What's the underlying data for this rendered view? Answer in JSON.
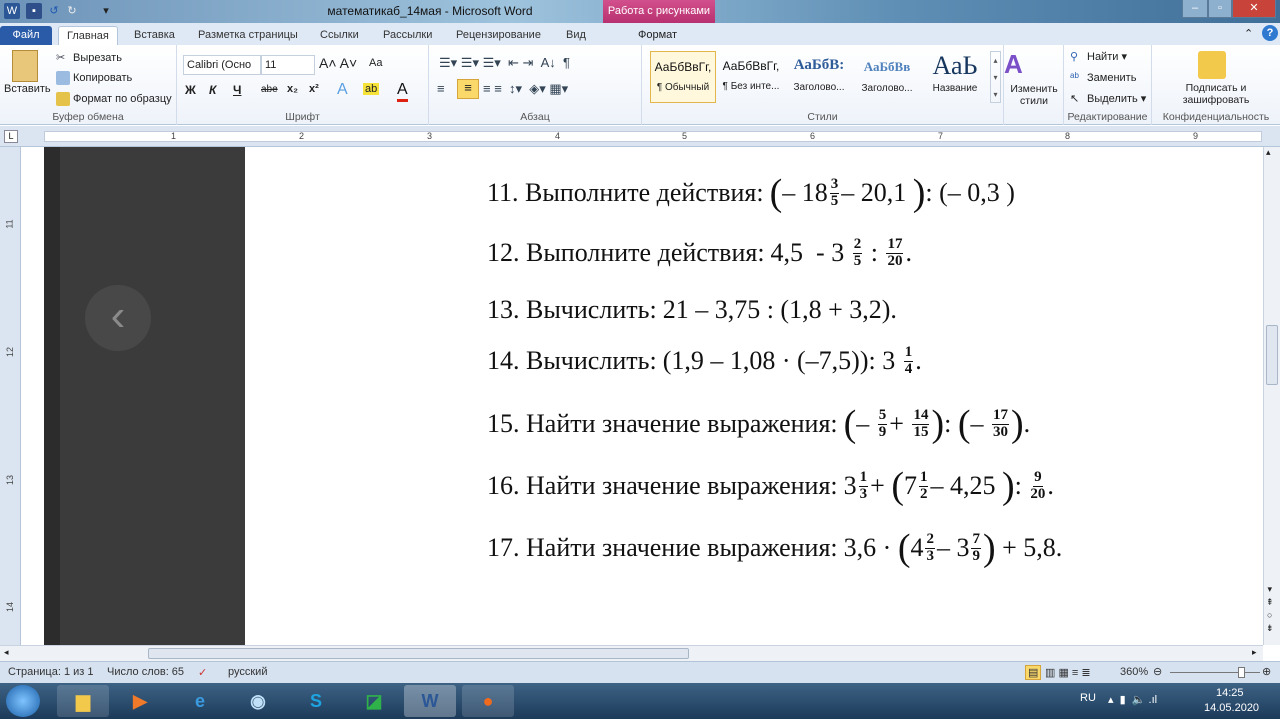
{
  "window": {
    "title": "математикаб_14мая  -  Microsoft Word",
    "context_group": "Работа с рисунками",
    "quick_access": [
      "W",
      "save",
      "undo",
      "redo",
      "customize"
    ]
  },
  "tabs": [
    "Файл",
    "Главная",
    "Вставка",
    "Разметка страницы",
    "Ссылки",
    "Рассылки",
    "Рецензирование",
    "Вид",
    "Формат"
  ],
  "ribbon": {
    "clipboard": {
      "label": "Буфер обмена",
      "paste": "Вставить",
      "cut": "Вырезать",
      "copy": "Копировать",
      "format_painter": "Формат по образцу"
    },
    "font": {
      "label": "Шрифт",
      "font_name": "Calibri (Осно",
      "font_size": "11",
      "bold": "Ж",
      "italic": "К",
      "underline": "Ч",
      "strike": "abe",
      "sub": "x₂",
      "sup": "x²",
      "case": "Aa"
    },
    "paragraph": {
      "label": "Абзац"
    },
    "styles": {
      "label": "Стили",
      "items": [
        {
          "sample": "АаБбВвГг,",
          "name": "¶ Обычный"
        },
        {
          "sample": "АаБбВвГг,",
          "name": "¶ Без инте..."
        },
        {
          "sample": "АаБбВ:",
          "name": "Заголово..."
        },
        {
          "sample": "АаБбВв",
          "name": "Заголово..."
        },
        {
          "sample": "АаЬ",
          "name": "Название"
        }
      ],
      "change": "Изменить стили"
    },
    "editing": {
      "label": "Редактирование",
      "find": "Найти",
      "replace": "Заменить",
      "select": "Выделить"
    },
    "privacy": {
      "label": "Конфиденциальность",
      "sign": "Подписать и зашифровать"
    }
  },
  "ruler": {
    "h": [
      "1",
      "2",
      "3",
      "4",
      "5",
      "6",
      "7",
      "8",
      "9"
    ],
    "v": [
      "11",
      "12",
      "13",
      "14"
    ]
  },
  "document": {
    "problems": [
      {
        "label": "11. Выполните действия:",
        "expr": [
          {
            "t": "("
          },
          {
            "t": "– 18"
          },
          {
            "n": "3",
            "d": "5"
          },
          {
            "t": "– 20,1 "
          },
          {
            "t": ")"
          },
          {
            "t": ": (– 0,3 )"
          }
        ]
      },
      {
        "label": "12. Выполните действия:",
        "expr": [
          {
            "t": "4,5  - 3 "
          },
          {
            "n": "2",
            "d": "5"
          },
          {
            "t": " : "
          },
          {
            "n": "17",
            "d": "20"
          },
          {
            "t": "."
          }
        ]
      },
      {
        "label": "13. Вычислить:",
        "expr": [
          {
            "t": "21 – 3,75 : (1,8 + 3,2)."
          }
        ]
      },
      {
        "label": "14. Вычислить:",
        "expr": [
          {
            "t": "(1,9 – 1,08 · (–7,5)): 3 "
          },
          {
            "n": "1",
            "d": "4"
          },
          {
            "t": "."
          }
        ]
      },
      {
        "label": "15. Найти значение выражения:",
        "expr": [
          {
            "t": "("
          },
          {
            "t": "– "
          },
          {
            "n": "5",
            "d": "9"
          },
          {
            "t": "+ "
          },
          {
            "n": "14",
            "d": "15"
          },
          {
            "t": ")"
          },
          {
            "t": ": "
          },
          {
            "t": "("
          },
          {
            "t": "– "
          },
          {
            "n": "17",
            "d": "30"
          },
          {
            "t": ")"
          },
          {
            "t": "."
          }
        ]
      },
      {
        "label": "16. Найти значение выражения:",
        "expr": [
          {
            "t": "3"
          },
          {
            "n": "1",
            "d": "3"
          },
          {
            "t": "+ "
          },
          {
            "t": "("
          },
          {
            "t": "7"
          },
          {
            "n": "1",
            "d": "2"
          },
          {
            "t": "– 4,25 "
          },
          {
            "t": ")"
          },
          {
            "t": ": "
          },
          {
            "n": "9",
            "d": "20"
          },
          {
            "t": "."
          }
        ]
      },
      {
        "label": "17. Найти значение выражения:",
        "expr": [
          {
            "t": "3,6 · "
          },
          {
            "t": "("
          },
          {
            "t": "4"
          },
          {
            "n": "2",
            "d": "3"
          },
          {
            "t": "– 3"
          },
          {
            "n": "7",
            "d": "9"
          },
          {
            "t": ")"
          },
          {
            "t": " + 5,8."
          }
        ]
      }
    ]
  },
  "status": {
    "page": "Страница: 1 из 1",
    "words": "Число слов: 65",
    "language": "русский",
    "zoom": "360%"
  },
  "taskbar": {
    "lang": "RU",
    "time": "14:25",
    "date": "14.05.2020"
  },
  "colors": {
    "file_tab": "#2a5ba8",
    "context": "#c03a7a",
    "dark_panel": "#3b3b3b"
  }
}
